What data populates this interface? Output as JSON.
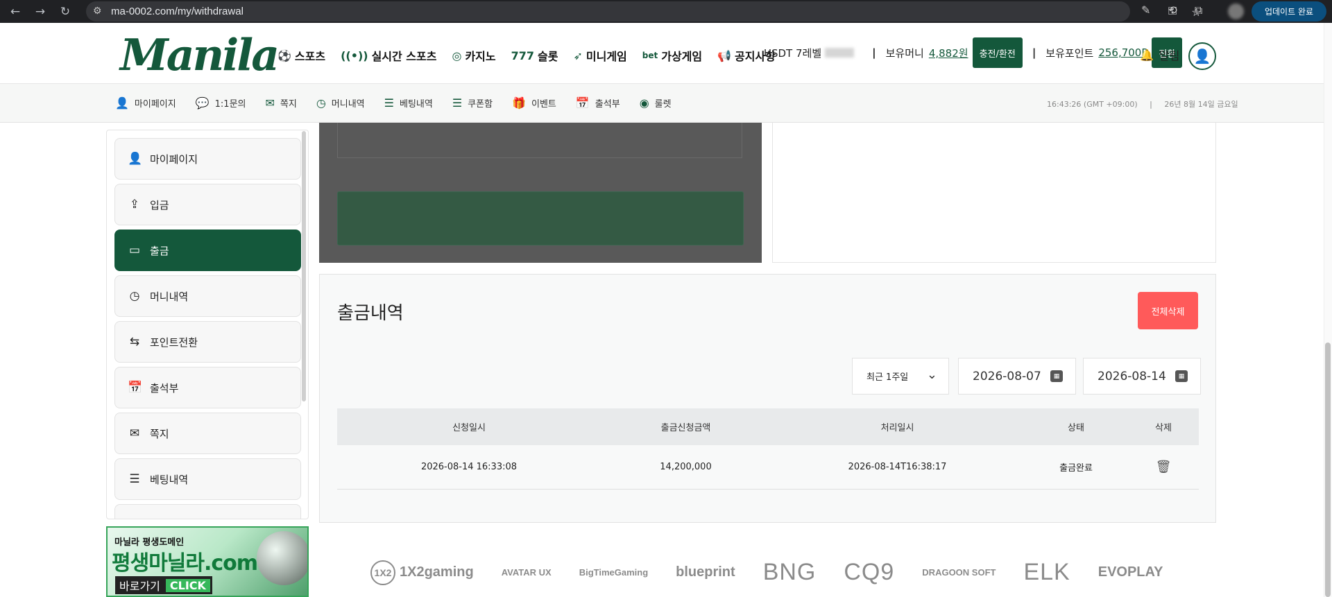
{
  "browser": {
    "url": "ma-0002.com/my/withdrawal",
    "update_label": "업데이트 완료"
  },
  "header": {
    "logo": "Manila",
    "nav": [
      {
        "label": "스포츠",
        "icon": "soccer-ball-icon"
      },
      {
        "label": "실시간 스포츠",
        "icon": "live-signal-icon"
      },
      {
        "label": "카지노",
        "icon": "casino-chip-icon"
      },
      {
        "label": "슬롯",
        "icon": "slot-777-icon"
      },
      {
        "label": "미니게임",
        "icon": "rocket-icon"
      },
      {
        "label": "가상게임",
        "icon": "bet-icon"
      },
      {
        "label": "공지사항",
        "icon": "megaphone-icon"
      }
    ],
    "user_level": "USDT 7레벨",
    "money_label": "보유머니",
    "money_value": "4,882원",
    "charge_button": "충전/환전",
    "point_label": "보유포인트",
    "point_value": "256,700P",
    "convert_button": "전환",
    "alarm_label": "알림"
  },
  "subnav": {
    "items": [
      {
        "label": "마이페이지",
        "icon": "user-icon"
      },
      {
        "label": "1:1문의",
        "icon": "chat-question-icon"
      },
      {
        "label": "쪽지",
        "icon": "envelope-icon"
      },
      {
        "label": "머니내역",
        "icon": "clock-icon"
      },
      {
        "label": "베팅내역",
        "icon": "list-icon"
      },
      {
        "label": "쿠폰함",
        "icon": "coupon-icon"
      },
      {
        "label": "이벤트",
        "icon": "gift-icon"
      },
      {
        "label": "출석부",
        "icon": "calendar-icon"
      },
      {
        "label": "룰렛",
        "icon": "roulette-icon"
      }
    ],
    "time": "16:43:26 (GMT +09:00)",
    "date": "26년 8월 14일 금요일"
  },
  "sidebar": {
    "items": [
      {
        "label": "마이페이지",
        "icon": "user-icon",
        "active": false
      },
      {
        "label": "입금",
        "icon": "deposit-icon",
        "active": false
      },
      {
        "label": "출금",
        "icon": "withdraw-icon",
        "active": true
      },
      {
        "label": "머니내역",
        "icon": "clock-icon",
        "active": false
      },
      {
        "label": "포인트전환",
        "icon": "swap-icon",
        "active": false
      },
      {
        "label": "출석부",
        "icon": "calendar-icon",
        "active": false
      },
      {
        "label": "쪽지",
        "icon": "envelope-icon",
        "active": false
      },
      {
        "label": "베팅내역",
        "icon": "list-icon",
        "active": false
      }
    ]
  },
  "banner": {
    "top": "마닐라 평생도메인",
    "main": "평생마닐라.com",
    "go_label": "바로가기",
    "click_label": "CLICK"
  },
  "history": {
    "title": "출금내역",
    "delete_all": "전체삭제",
    "period": "최근 1주일",
    "date_from": "2026-08-07",
    "date_to": "2026-08-14",
    "columns": [
      "신청일시",
      "출금신청금액",
      "처리일시",
      "상태",
      "삭제"
    ],
    "rows": [
      {
        "requested": "2026-08-14 16:33:08",
        "amount": "14,200,000",
        "processed": "2026-08-14T16:38:17",
        "status": "출금완료"
      }
    ]
  },
  "providers": [
    "1X2gaming",
    "AVATAR UX",
    "BigTimeGaming",
    "blueprint",
    "BNG",
    "CQ9",
    "DRAGOON SOFT",
    "ELK",
    "EVOPLAY"
  ]
}
